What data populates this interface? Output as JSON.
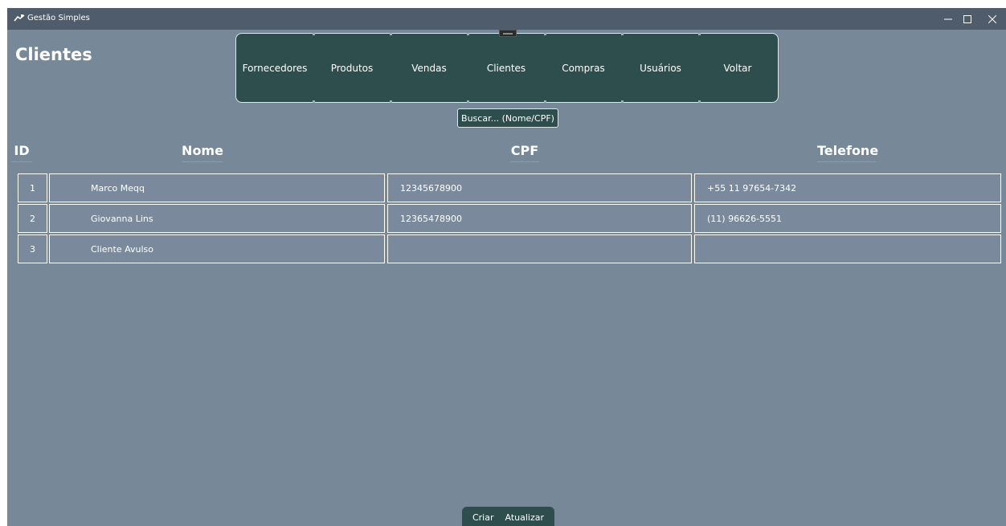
{
  "window": {
    "title": "Gestão Simples",
    "app_icon": "app-logo-icon",
    "controls": [
      "minimize-icon",
      "maximize-icon",
      "close-icon"
    ]
  },
  "page": {
    "title": "Clientes"
  },
  "nav": {
    "items": [
      {
        "label": "Fornecedores"
      },
      {
        "label": "Produtos"
      },
      {
        "label": "Vendas"
      },
      {
        "label": "Clientes"
      },
      {
        "label": "Compras"
      },
      {
        "label": "Usuários"
      },
      {
        "label": "Voltar"
      }
    ]
  },
  "search": {
    "placeholder": "Buscar... (Nome/CPF)"
  },
  "table": {
    "headers": {
      "id": "ID",
      "nome": "Nome",
      "cpf": "CPF",
      "telefone": "Telefone"
    },
    "rows": [
      {
        "id": "1",
        "nome": "Marco Meqq",
        "cpf": "12345678900",
        "telefone": "+55 11 97654-7342"
      },
      {
        "id": "2",
        "nome": "Giovanna Lins",
        "cpf": "12365478900",
        "telefone": "(11) 96626-5551"
      },
      {
        "id": "3",
        "nome": "Cliente Avulso",
        "cpf": "",
        "telefone": ""
      }
    ]
  },
  "actions": {
    "create_label": "Criar",
    "refresh_label": "Atualizar"
  },
  "colors": {
    "background": "#778898",
    "titlebar": "#4f5c6b",
    "panel": "#2e4e4d",
    "text": "#ffffff"
  }
}
